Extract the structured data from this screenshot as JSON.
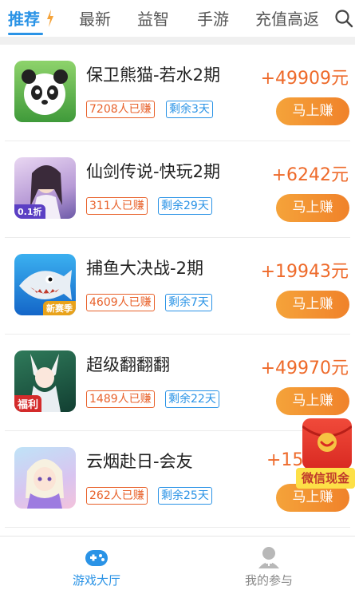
{
  "tabs": [
    {
      "label": "推荐",
      "active": true
    },
    {
      "label": "最新"
    },
    {
      "label": "益智"
    },
    {
      "label": "手游"
    },
    {
      "label": "充值高返"
    }
  ],
  "colors": {
    "accent": "#2a93e6",
    "reward": "#ee6a2a",
    "button": "#f0822a"
  },
  "items": [
    {
      "title": "保卫熊猫-若水2期",
      "reward": "+49909元",
      "earned": "7208人已赚",
      "remaining": "剩余3天",
      "button": "马上赚",
      "thumb_badge": ""
    },
    {
      "title": "仙剑传说-快玩2期",
      "reward": "+6242元",
      "earned": "311人已赚",
      "remaining": "剩余29天",
      "button": "马上赚",
      "thumb_badge": "0.1折"
    },
    {
      "title": "捕鱼大决战-2期",
      "reward": "+19943元",
      "earned": "4609人已赚",
      "remaining": "剩余7天",
      "button": "马上赚",
      "thumb_badge": "新赛季"
    },
    {
      "title": "超级翻翻翻",
      "reward": "+49970元",
      "earned": "1489人已赚",
      "remaining": "剩余22天",
      "button": "马上赚",
      "thumb_badge": "福利"
    },
    {
      "title": "云烟赴日-会友",
      "reward": "+15",
      "earned": "262人已赚",
      "remaining": "剩余25天",
      "button": "马上赚",
      "thumb_badge": ""
    }
  ],
  "floating": {
    "label": "微信现金"
  },
  "bottom_nav": [
    {
      "label": "游戏大厅",
      "active": true,
      "icon": "gamepad-icon"
    },
    {
      "label": "我的参与",
      "active": false,
      "icon": "user-icon"
    }
  ]
}
